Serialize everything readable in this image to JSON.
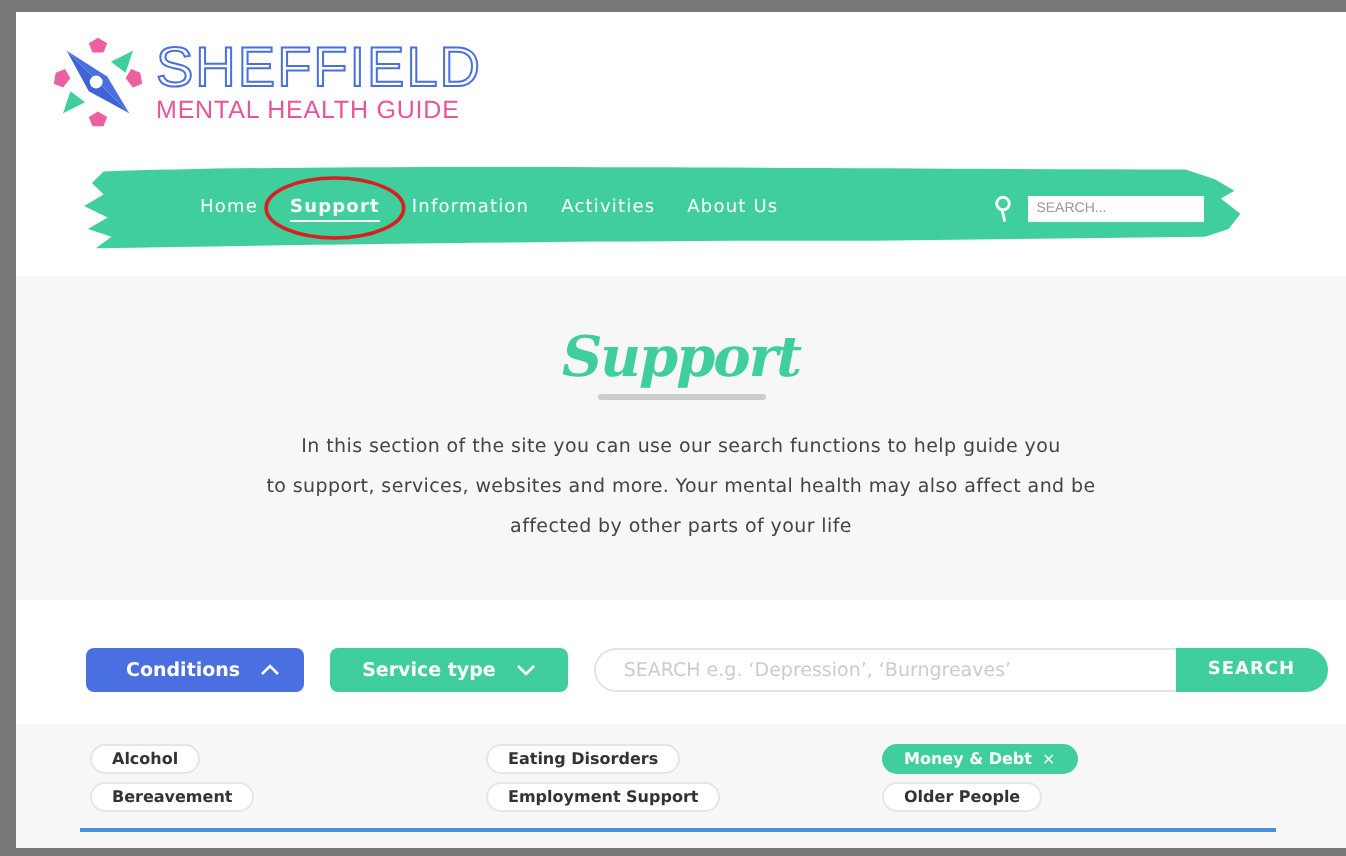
{
  "logo": {
    "title": "SHEFFIELD",
    "subtitle": "MENTAL HEALTH GUIDE"
  },
  "nav": {
    "items": [
      {
        "label": "Home",
        "selected": false
      },
      {
        "label": "Support",
        "selected": true
      },
      {
        "label": "Information",
        "selected": false
      },
      {
        "label": "Activities",
        "selected": false
      },
      {
        "label": "About Us",
        "selected": false
      }
    ],
    "search": {
      "placeholder": "SEARCH..."
    }
  },
  "hero": {
    "title": "Support",
    "lines": [
      "In this section of the site you can use our search functions to help guide you",
      "to support, services, websites and more. Your mental health may also affect and be",
      "affected by other parts of your life"
    ]
  },
  "filters": {
    "dropdowns": [
      {
        "label": "Conditions",
        "expanded": true
      },
      {
        "label": "Service type",
        "expanded": false
      }
    ],
    "search": {
      "placeholder": "SEARCH e.g. ‘Depression’, ‘Burngreaves’",
      "button": "SEARCH"
    }
  },
  "tag_columns": [
    [
      {
        "label": "Alcohol",
        "selected": false
      },
      {
        "label": "Bereavement",
        "selected": false
      }
    ],
    [
      {
        "label": "Eating Disorders",
        "selected": false
      },
      {
        "label": "Employment Support",
        "selected": false
      }
    ],
    [
      {
        "label": "Money & Debt",
        "selected": true,
        "remove": "×"
      },
      {
        "label": "Older People",
        "selected": false
      }
    ]
  ]
}
